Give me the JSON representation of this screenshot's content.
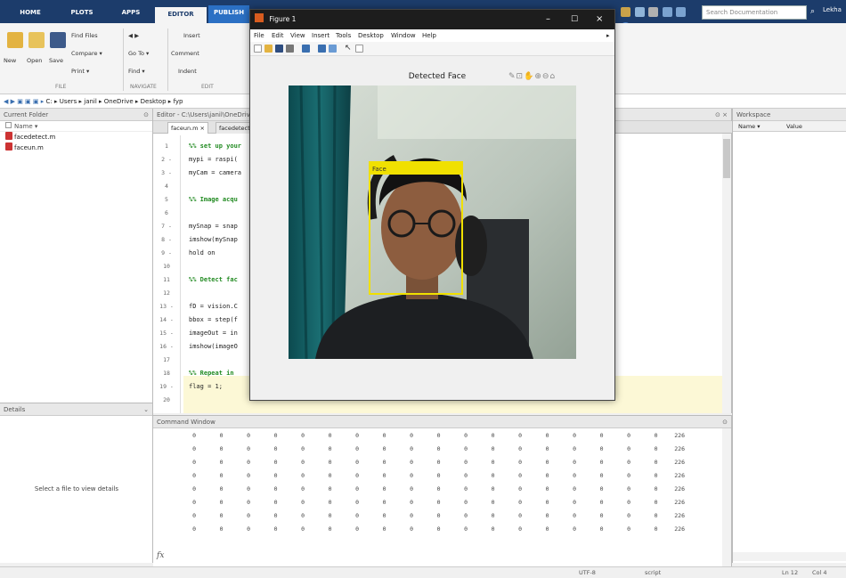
{
  "ribbon_tabs": [
    {
      "label": "HOME",
      "active": false
    },
    {
      "label": "PLOTS",
      "active": false
    },
    {
      "label": "APPS",
      "active": false
    },
    {
      "label": "EDITOR",
      "active": true
    },
    {
      "label": "PUBLISH",
      "active": false
    }
  ],
  "search": {
    "placeholder": "Search Documentation"
  },
  "user": {
    "name": "Lekha"
  },
  "ribbon": {
    "file": {
      "new": "New",
      "open": "Open",
      "save": "Save",
      "find_files": "Find Files",
      "compare": "Compare ▾",
      "print": "Print ▾",
      "group": "FILE"
    },
    "navigate": {
      "go_to": "Go To ▾",
      "find": "Find ▾",
      "group": "NAVIGATE"
    },
    "edit": {
      "insert": "Insert",
      "comment": "Comment",
      "indent": "Indent",
      "group": "EDIT"
    }
  },
  "address": {
    "path": "C: ▸ Users ▸ janil ▸ OneDrive ▸ Desktop ▸ fyp"
  },
  "current_folder": {
    "title": "Current Folder",
    "col_header": "Name ▾",
    "files": [
      "facedetect.m",
      "faceun.m"
    ]
  },
  "details": {
    "title": "Details",
    "message": "Select a file to view details"
  },
  "editor": {
    "title": "Editor - C:\\Users\\janil\\OneDrive\\Desktop\\fyp\\faceun.m",
    "tabs": [
      "faceun.m",
      "facedetect.m"
    ],
    "lines": [
      {
        "n": "1",
        "code": "%% set up your",
        "comment": true
      },
      {
        "n": "2 -",
        "code": "mypi = raspi(",
        "comment": false
      },
      {
        "n": "3 -",
        "code": "myCam = camera",
        "comment": false
      },
      {
        "n": "4",
        "code": "",
        "comment": false
      },
      {
        "n": "5",
        "code": "%% Image acqu",
        "comment": true
      },
      {
        "n": "6",
        "code": "",
        "comment": false
      },
      {
        "n": "7 -",
        "code": "mySnap = snap",
        "comment": false
      },
      {
        "n": "8 -",
        "code": "imshow(mySnap",
        "comment": false
      },
      {
        "n": "9 -",
        "code": "hold on",
        "comment": false
      },
      {
        "n": "10",
        "code": "",
        "comment": false
      },
      {
        "n": "11",
        "code": "%% Detect fac",
        "comment": true
      },
      {
        "n": "12",
        "code": "",
        "comment": false
      },
      {
        "n": "13 -",
        "code": "fD = vision.C",
        "comment": false
      },
      {
        "n": "14 -",
        "code": "bbox = step(f",
        "comment": false
      },
      {
        "n": "15 -",
        "code": "imageOut = in",
        "comment": false
      },
      {
        "n": "16 -",
        "code": "imshow(imageO",
        "comment": false
      },
      {
        "n": "17",
        "code": "",
        "comment": false
      },
      {
        "n": "18",
        "code": "%% Repeat in",
        "comment": true
      },
      {
        "n": "19 -",
        "code": "flag = 1;",
        "comment": false
      },
      {
        "n": "20",
        "code": "",
        "comment": false
      }
    ]
  },
  "command_window": {
    "title": "Command Window",
    "rows": [
      [
        "0",
        "0",
        "0",
        "0",
        "0",
        "0",
        "0",
        "0",
        "0",
        "0",
        "0",
        "0",
        "0",
        "0",
        "0",
        "0",
        "0",
        "0",
        "226"
      ],
      [
        "0",
        "0",
        "0",
        "0",
        "0",
        "0",
        "0",
        "0",
        "0",
        "0",
        "0",
        "0",
        "0",
        "0",
        "0",
        "0",
        "0",
        "0",
        "226"
      ],
      [
        "0",
        "0",
        "0",
        "0",
        "0",
        "0",
        "0",
        "0",
        "0",
        "0",
        "0",
        "0",
        "0",
        "0",
        "0",
        "0",
        "0",
        "0",
        "226"
      ],
      [
        "0",
        "0",
        "0",
        "0",
        "0",
        "0",
        "0",
        "0",
        "0",
        "0",
        "0",
        "0",
        "0",
        "0",
        "0",
        "0",
        "0",
        "0",
        "226"
      ],
      [
        "0",
        "0",
        "0",
        "0",
        "0",
        "0",
        "0",
        "0",
        "0",
        "0",
        "0",
        "0",
        "0",
        "0",
        "0",
        "0",
        "0",
        "0",
        "226"
      ],
      [
        "0",
        "0",
        "0",
        "0",
        "0",
        "0",
        "0",
        "0",
        "0",
        "0",
        "0",
        "0",
        "0",
        "0",
        "0",
        "0",
        "0",
        "0",
        "226"
      ],
      [
        "0",
        "0",
        "0",
        "0",
        "0",
        "0",
        "0",
        "0",
        "0",
        "0",
        "0",
        "0",
        "0",
        "0",
        "0",
        "0",
        "0",
        "0",
        "226"
      ],
      [
        "0",
        "0",
        "0",
        "0",
        "0",
        "0",
        "0",
        "0",
        "0",
        "0",
        "0",
        "0",
        "0",
        "0",
        "0",
        "0",
        "0",
        "0",
        "226"
      ]
    ],
    "prompt": "fx"
  },
  "workspace": {
    "title": "Workspace",
    "col_name": "Name ▾",
    "col_value": "Value"
  },
  "status": {
    "encoding": "UTF-8",
    "script": "script",
    "ln": "Ln 12",
    "col": "Col 4"
  },
  "figure": {
    "title": "Figure 1",
    "menu": [
      "File",
      "Edit",
      "View",
      "Insert",
      "Tools",
      "Desktop",
      "Window",
      "Help"
    ],
    "axes_title": "Detected Face",
    "box_label": "Face",
    "box_color": "#f0e000"
  }
}
